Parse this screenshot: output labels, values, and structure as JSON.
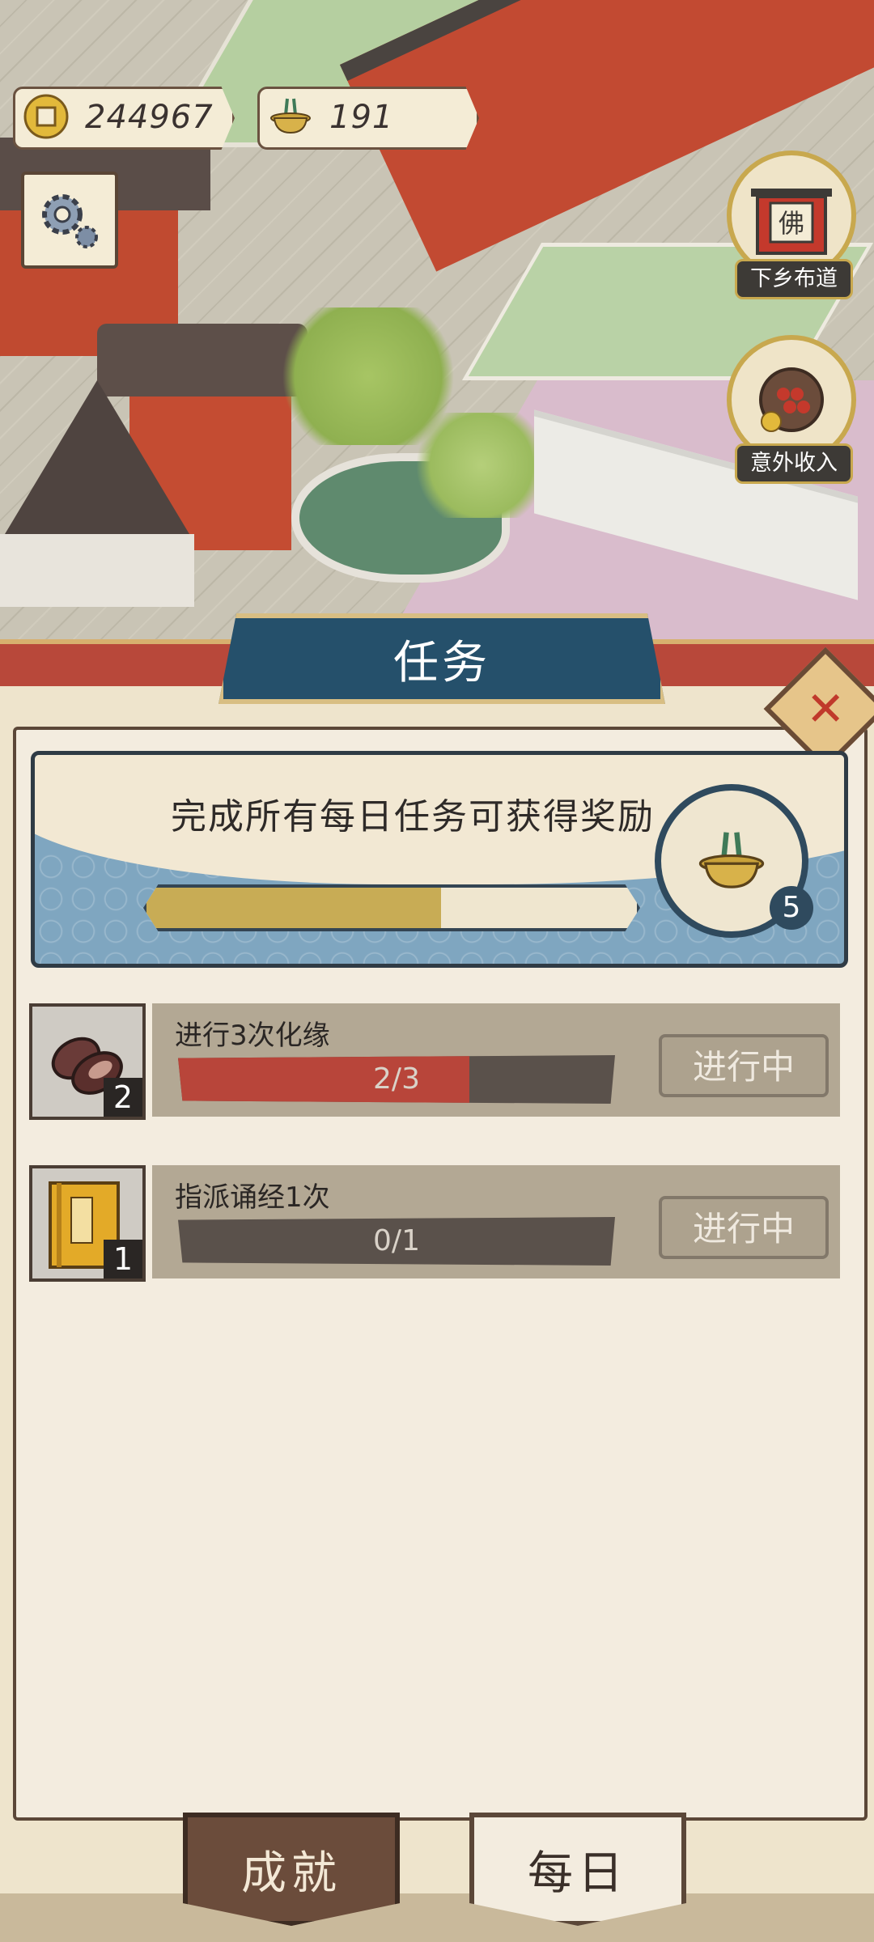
{
  "hud": {
    "coins": "244967",
    "incense": "191"
  },
  "side_buttons": {
    "preach_label": "下乡布道",
    "preach_emblem": "佛",
    "income_label": "意外收入"
  },
  "panel": {
    "title": "任务",
    "close_icon": "close-x-icon"
  },
  "reward": {
    "text": "完成所有每日任务可获得奖励",
    "progress": 0.6,
    "reward_count": "5"
  },
  "tasks": [
    {
      "name": "进行3次化缘",
      "progress_text": "2/3",
      "progress": 0.667,
      "count": "2",
      "status": "进行中",
      "icon": "shoes-icon"
    },
    {
      "name": "指派诵经1次",
      "progress_text": "0/1",
      "progress": 0.0,
      "count": "1",
      "status": "进行中",
      "icon": "scripture-book-icon"
    }
  ],
  "tabs": {
    "achievements": "成就",
    "daily": "每日"
  },
  "colors": {
    "panel_bg": "#f3ecdf",
    "banner_blue": "#25506b",
    "progress_gold": "#c8ac55",
    "task_progress_red": "#b8453a",
    "accent_gold": "#c8a84e"
  }
}
